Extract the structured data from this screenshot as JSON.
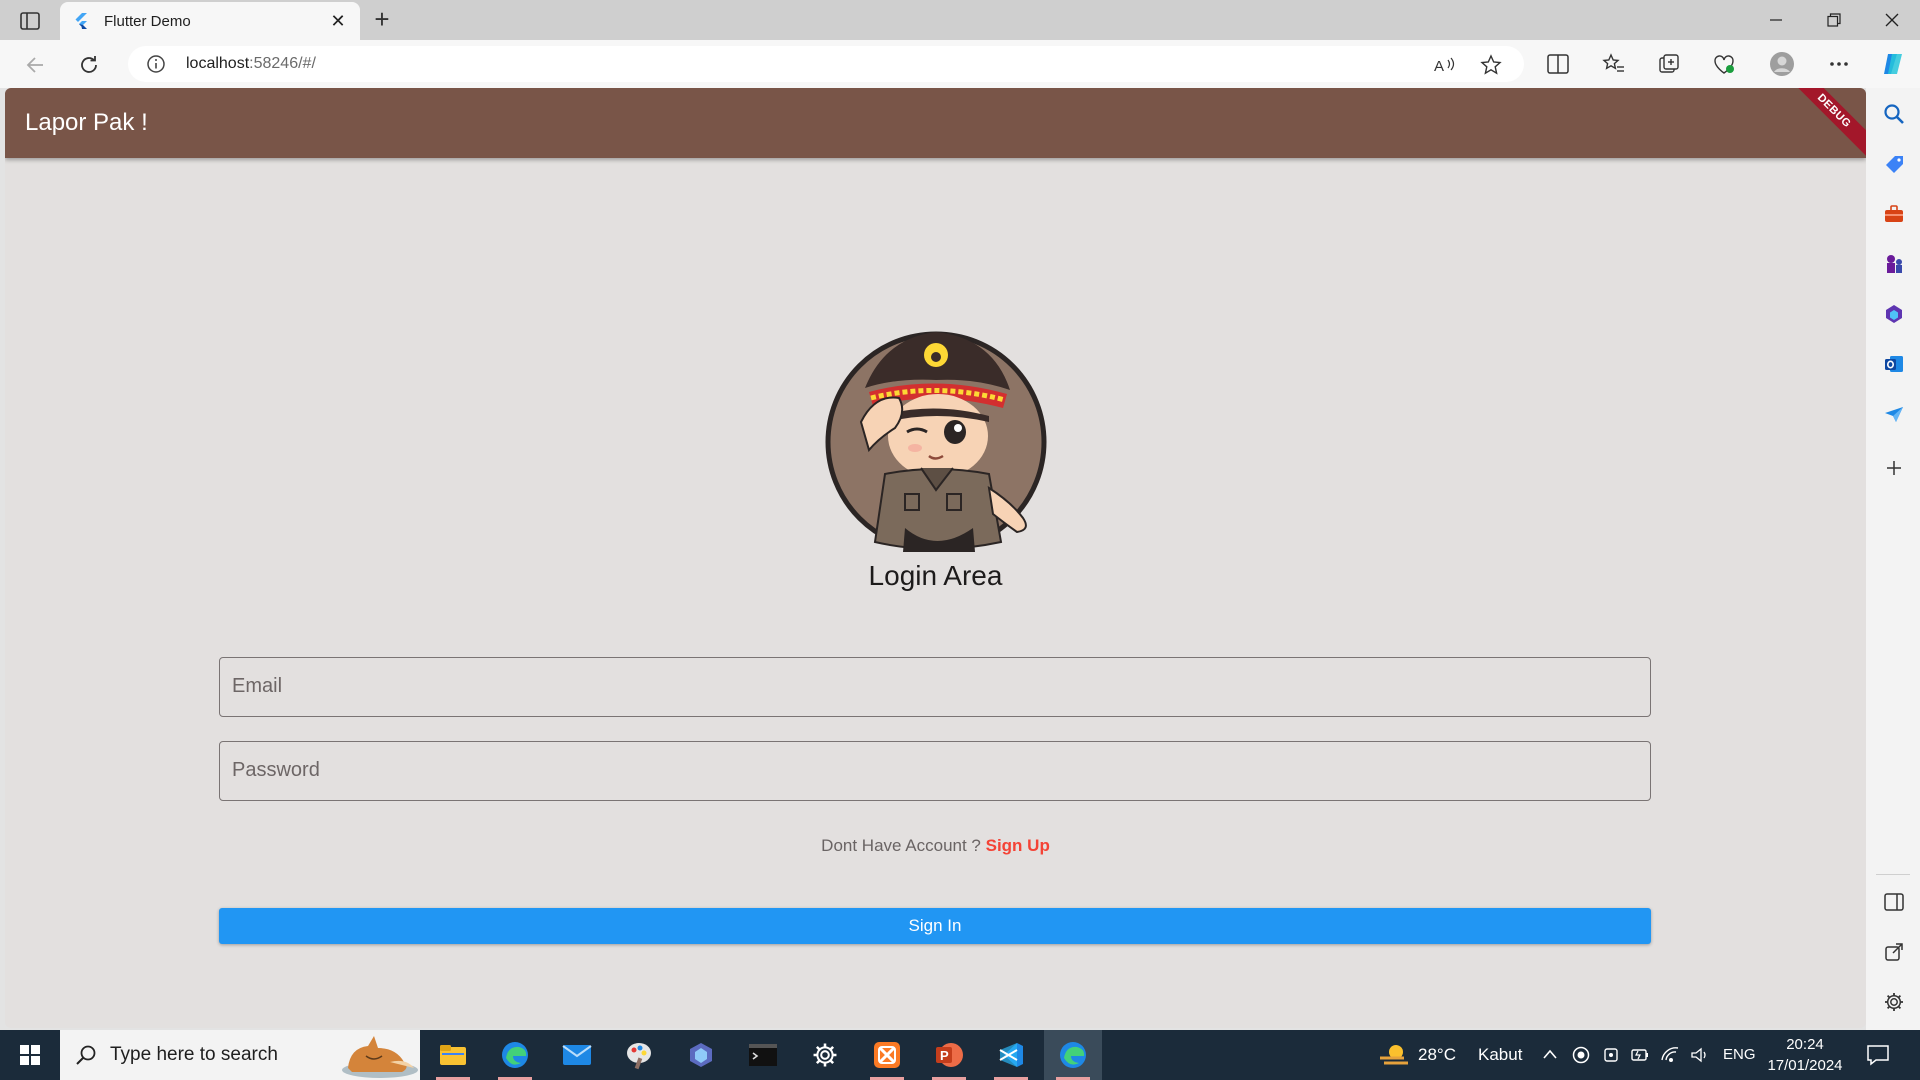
{
  "browser": {
    "tab_title": "Flutter Demo",
    "url_host": "localhost",
    "url_rest": ":58246/#/"
  },
  "app": {
    "appbar_title": "Lapor Pak !",
    "debug_banner": "DEBUG",
    "login_title": "Login Area",
    "email_placeholder": "Email",
    "password_placeholder": "Password",
    "signup_prompt": "Dont Have Account ? ",
    "signup_link": "Sign Up",
    "signin_label": "Sign In"
  },
  "taskbar": {
    "search_placeholder": "Type here to search",
    "weather_temp": "28°C",
    "weather_desc": "Kabut",
    "language": "ENG",
    "time": "20:24",
    "date": "17/01/2024"
  },
  "colors": {
    "appbar": "#795548",
    "signin_button": "#2196f3",
    "signup_link": "#f44336",
    "debug_banner": "#a3172a"
  }
}
